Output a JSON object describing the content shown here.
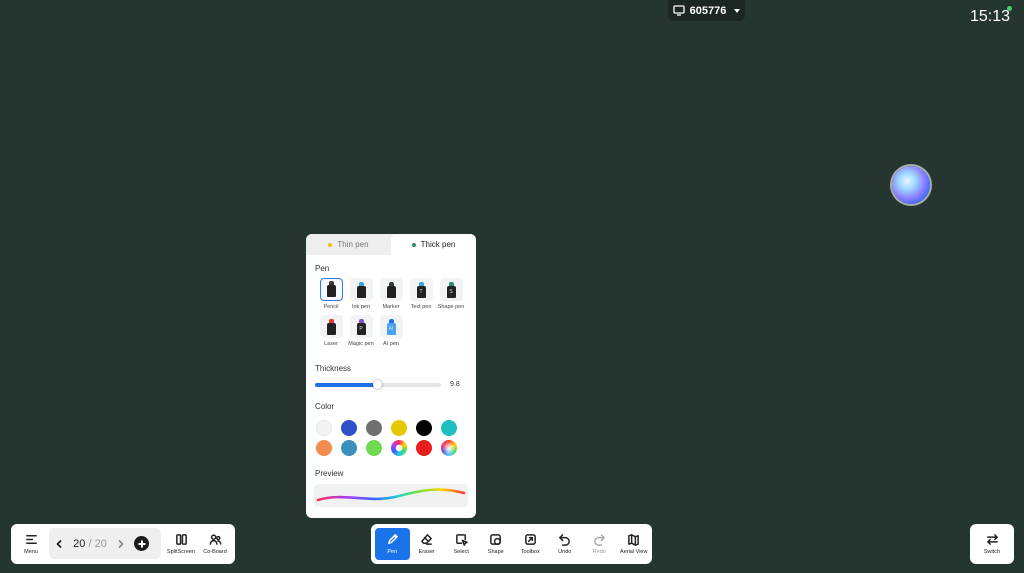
{
  "top_bar": {
    "screen_code": "605776",
    "time": "15:13"
  },
  "pen_panel": {
    "tabs": [
      {
        "label": "Thin pen",
        "dot_color": "#e8c21c",
        "active": false
      },
      {
        "label": "Thick pen",
        "dot_color": "#2e8b6e",
        "active": true
      }
    ],
    "pen_section_label": "Pen",
    "pens": [
      {
        "label": "Pencil",
        "icon": "pencil-icon",
        "mark": "",
        "tip": "#3a3a3a",
        "selected": true
      },
      {
        "label": "Ink pen",
        "icon": "ink-pen-icon",
        "mark": "",
        "tip": "#3aa0d8"
      },
      {
        "label": "Marker",
        "icon": "marker-icon",
        "mark": "",
        "tip": "#3a3a3a"
      },
      {
        "label": "Text pen",
        "icon": "text-pen-icon",
        "mark": "T",
        "tip": "#3aa0d8"
      },
      {
        "label": "Shape pen",
        "icon": "shape-pen-icon",
        "mark": "S",
        "tip": "#2e8b6e"
      },
      {
        "label": "Laser",
        "icon": "laser-icon",
        "mark": "",
        "tip": "#e53935"
      },
      {
        "label": "Magic pen",
        "icon": "magic-pen-icon",
        "mark": "P",
        "tip": "#7e57c2"
      },
      {
        "label": "AI pen",
        "icon": "ai-pen-icon",
        "mark": "AI",
        "tip": "#1a73e8",
        "body": "#4aa3f0"
      }
    ],
    "thickness_label": "Thickness",
    "thickness_value": "9.8",
    "thickness_fraction": 0.49,
    "color_label": "Color",
    "colors": [
      "#f2f2f2",
      "#3050c8",
      "#707070",
      "#e6c800",
      "#000000",
      "#1fbfbf",
      "#f58c4b",
      "#3a8fbf",
      "#6fd94f",
      "rainbow-ring",
      "#e61e1e",
      "rainbow-wheel"
    ],
    "selected_color": "rainbow-ring",
    "preview_label": "Preview"
  },
  "left_toolbar": {
    "menu_label": "Menu",
    "page_current": "20",
    "page_separator": "/",
    "page_total": "20",
    "split_label": "SplitScreen",
    "coboard_label": "Co-Board"
  },
  "center_toolbar": {
    "tools": [
      {
        "label": "Pen",
        "icon": "pen-icon",
        "active": true
      },
      {
        "label": "Eraser",
        "icon": "eraser-icon"
      },
      {
        "label": "Select",
        "icon": "select-icon"
      },
      {
        "label": "Shape",
        "icon": "shape-icon"
      },
      {
        "label": "Toolbox",
        "icon": "toolbox-icon"
      },
      {
        "label": "Undo",
        "icon": "undo-icon"
      },
      {
        "label": "Redo",
        "icon": "redo-icon",
        "disabled": true
      },
      {
        "label": "Aerial View",
        "icon": "aerial-view-icon"
      }
    ]
  },
  "right_toolbar": {
    "switch_label": "Switch"
  }
}
